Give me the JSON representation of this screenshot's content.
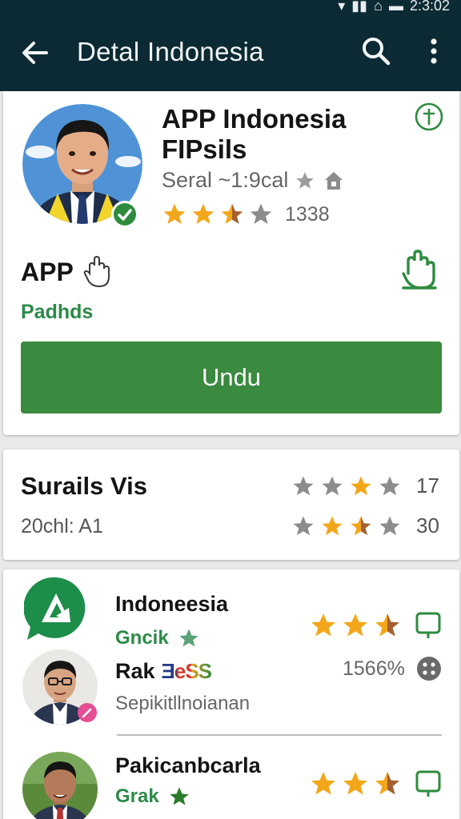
{
  "status_bar": {
    "time": "2:3:02"
  },
  "app_bar": {
    "title": "Detal Indonesia"
  },
  "app_header": {
    "title": "APP Indonesia FIPsils",
    "subtitle": "Seral ~1:9cal",
    "rating": 2.5,
    "rating_count": "1338",
    "app_label": "APP",
    "publisher": "Padhds",
    "install_label": "Undu"
  },
  "reviews": {
    "title": "Surails Vis",
    "subtitle": "20chl: A1",
    "rows": [
      {
        "rating": 1,
        "count": "17"
      },
      {
        "rating": 1.5,
        "count": "30"
      }
    ]
  },
  "list": {
    "items": [
      {
        "title": "Indoneesia",
        "subtitle": "Gncik",
        "rating": 2.5
      },
      {
        "title": "Rak",
        "brand_text": "ƎeSS",
        "subtitle": "Sepikitllnoianan",
        "percent": "1566%"
      },
      {
        "title": "Pakicanbcarla",
        "subtitle": "Grak",
        "rating": 2.5
      }
    ]
  },
  "colors": {
    "app_bar": "#0c2a33",
    "accent_green": "#3a8a40",
    "link_green": "#2b8a47",
    "star_gold": "#f2a71b",
    "star_gray": "#8c8c8c"
  }
}
